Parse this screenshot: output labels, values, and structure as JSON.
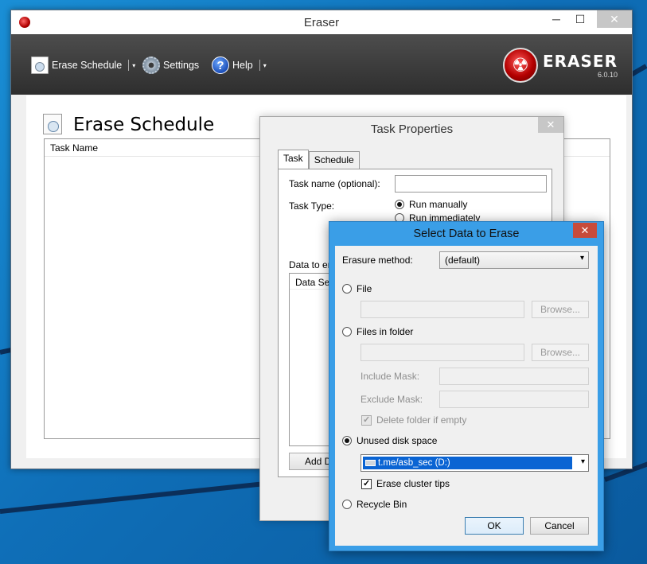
{
  "main_window": {
    "title": "Eraser",
    "controls": {
      "minimize": "─",
      "maximize": "☐",
      "close": "✕"
    }
  },
  "toolbar": {
    "erase_schedule": "Erase Schedule",
    "settings": "Settings",
    "help": "Help",
    "dropdown_arrow": "▾"
  },
  "logo": {
    "name": "ERASER",
    "version": "6.0.10"
  },
  "schedule": {
    "title": "Erase Schedule",
    "column_task_name": "Task Name"
  },
  "task_dialog": {
    "title": "Task Properties",
    "close": "✕",
    "tabs": [
      "Task",
      "Schedule"
    ],
    "task_name_label": "Task name (optional):",
    "task_name_value": "",
    "task_type_label": "Task Type:",
    "task_type_options": [
      "Run manually",
      "Run immediately"
    ],
    "data_to_erase_label": "Data to er",
    "data_set_column": "Data Set",
    "add_data_button": "Add Da"
  },
  "select_dialog": {
    "title": "Select Data to Erase",
    "close": "✕",
    "erasure_method_label": "Erasure method:",
    "erasure_method_value": "(default)",
    "file_label": "File",
    "file_browse": "Browse...",
    "folder_label": "Files in folder",
    "folder_browse": "Browse...",
    "include_mask_label": "Include Mask:",
    "exclude_mask_label": "Exclude Mask:",
    "delete_folder_label": "Delete folder if empty",
    "unused_space_label": "Unused disk space",
    "drive_value": "t.me/asb_sec (D:)",
    "cluster_tips_label": "Erase cluster tips",
    "recycle_bin_label": "Recycle Bin",
    "ok": "OK",
    "cancel": "Cancel",
    "combo_arrow": "▾"
  }
}
